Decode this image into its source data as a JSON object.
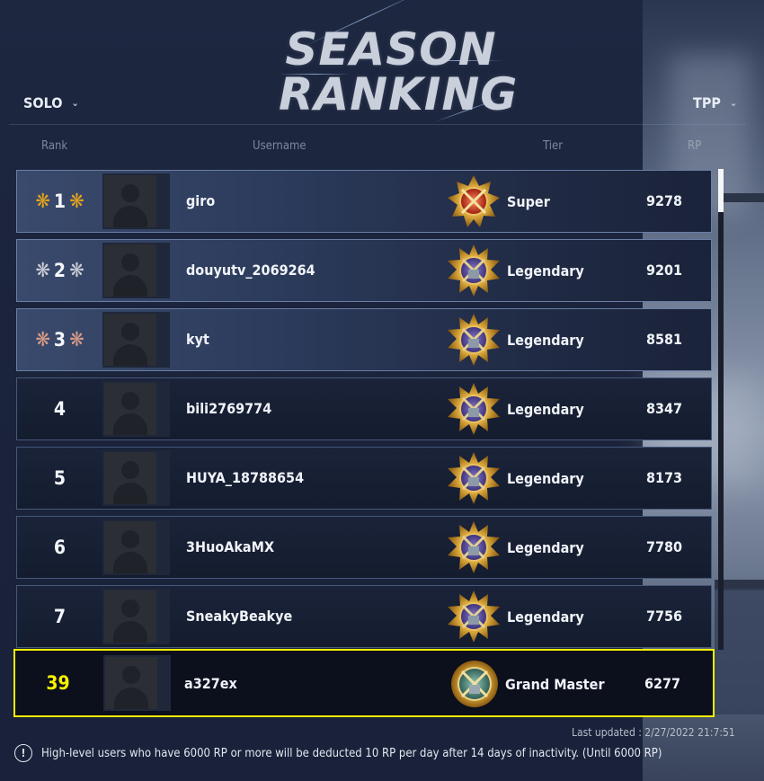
{
  "title": {
    "line1": "SEASON",
    "line2": "RANKING"
  },
  "mode_left": {
    "label": "SOLO",
    "chevron": "chevron-down-icon"
  },
  "mode_right": {
    "label": "TPP",
    "chevron": "chevron-down-icon"
  },
  "columns": {
    "rank": "Rank",
    "username": "Username",
    "tier": "Tier",
    "rp": "RP"
  },
  "rows": [
    {
      "rank": "1",
      "username": "giro",
      "tier": "Super",
      "rp": "9278",
      "medal": "gold"
    },
    {
      "rank": "2",
      "username": "douyutv_2069264",
      "tier": "Legendary",
      "rp": "9201",
      "medal": "silver"
    },
    {
      "rank": "3",
      "username": "kyt",
      "tier": "Legendary",
      "rp": "8581",
      "medal": "bronze"
    },
    {
      "rank": "4",
      "username": "bili2769774",
      "tier": "Legendary",
      "rp": "8347"
    },
    {
      "rank": "5",
      "username": "HUYA_18788654",
      "tier": "Legendary",
      "rp": "8173"
    },
    {
      "rank": "6",
      "username": "3HuoAkaMX",
      "tier": "Legendary",
      "rp": "7780"
    },
    {
      "rank": "7",
      "username": "SneakyBeakye",
      "tier": "Legendary",
      "rp": "7756"
    }
  ],
  "my_row": {
    "rank": "39",
    "username": "a327ex",
    "tier": "Grand Master",
    "rp": "6277"
  },
  "last_updated": "Last updated : 2/27/2022 21:7:51",
  "notice": "High-level users who have 6000 RP or more will be deducted 10 RP per day after 14 days of inactivity. (Until 6000 RP)",
  "colors": {
    "highlight": "#f6f200",
    "gold": "#e1a21c",
    "silver": "#c9ccd4",
    "bronze": "#d79a86"
  }
}
